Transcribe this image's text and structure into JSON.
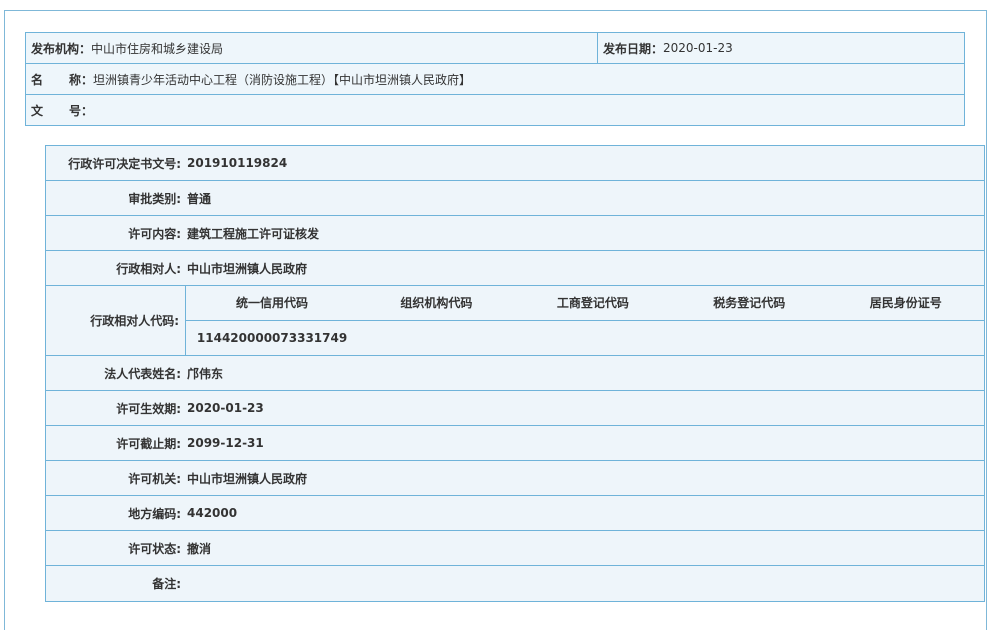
{
  "summary": {
    "publisher_label": "发布机构：",
    "publisher_value": "中山市住房和城乡建设局",
    "date_label": "发布日期：",
    "date_value": "2020-01-23",
    "name_label_a": "名",
    "name_label_b": "称：",
    "name_value": "坦洲镇青少年活动中心工程（消防设施工程）【中山市坦洲镇人民政府】",
    "doc_label_a": "文",
    "doc_label_b": "号：",
    "doc_value": ""
  },
  "detail": {
    "decision_no_label": "行政许可决定书文号:",
    "decision_no_value": "201910119824",
    "category_label": "审批类别:",
    "category_value": "普通",
    "content_label": "许可内容:",
    "content_value": "建筑工程施工许可证核发",
    "counterpart_label": "行政相对人:",
    "counterpart_value": "中山市坦洲镇人民政府",
    "codes_label": "行政相对人代码:",
    "codes_headers": [
      "统一信用代码",
      "组织机构代码",
      "工商登记代码",
      "税务登记代码",
      "居民身份证号"
    ],
    "codes_values": [
      "114420000073331749",
      "",
      "",
      "",
      ""
    ],
    "legal_rep_label": "法人代表姓名:",
    "legal_rep_value": "邝伟东",
    "valid_from_label": "许可生效期:",
    "valid_from_value": "2020-01-23",
    "valid_to_label": "许可截止期:",
    "valid_to_value": "2099-12-31",
    "authority_label": "许可机关:",
    "authority_value": "中山市坦洲镇人民政府",
    "region_code_label": "地方编码:",
    "region_code_value": "442000",
    "status_label": "许可状态:",
    "status_value": "撤消",
    "remark_label": "备注:",
    "remark_value": ""
  }
}
